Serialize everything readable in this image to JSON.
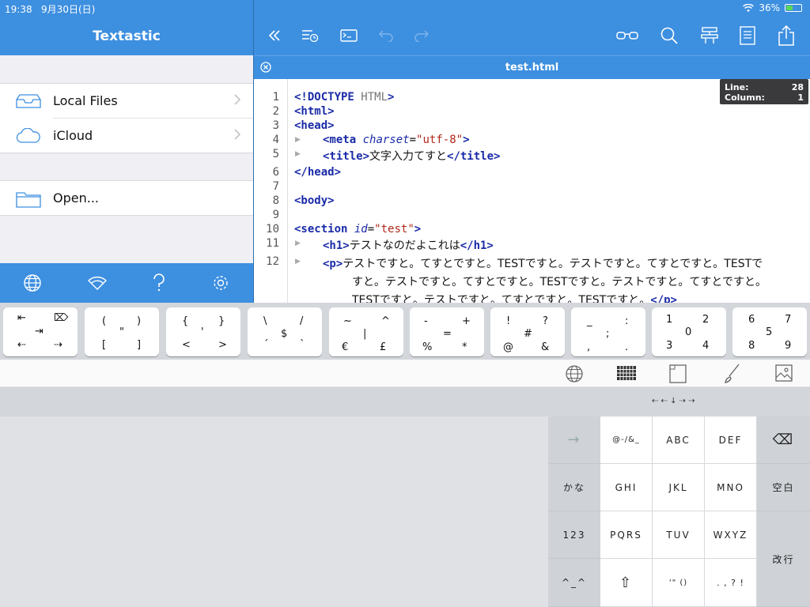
{
  "status": {
    "time": "19:38",
    "date": "9月30日(日)",
    "battery": "36%"
  },
  "sidebar": {
    "title": "Textastic",
    "items": [
      {
        "label": "Local Files",
        "icon": "tray-icon"
      },
      {
        "label": "iCloud",
        "icon": "cloud-icon"
      },
      {
        "label": "Open...",
        "icon": "folder-icon"
      }
    ],
    "footer_icons": [
      "globe-icon",
      "wifi-icon",
      "help-icon",
      "gear-icon"
    ]
  },
  "editor": {
    "file_title": "test.html",
    "line_info": {
      "line_label": "Line:",
      "line": "28",
      "col_label": "Column:",
      "col": "1"
    },
    "lines": [
      {
        "n": "1"
      },
      {
        "n": "2"
      },
      {
        "n": "3"
      },
      {
        "n": "4"
      },
      {
        "n": "5"
      },
      {
        "n": "6"
      },
      {
        "n": "7"
      },
      {
        "n": "8"
      },
      {
        "n": "9"
      },
      {
        "n": "10"
      },
      {
        "n": "11"
      },
      {
        "n": "12"
      }
    ],
    "code": {
      "l1a": "<!DOCTYPE",
      "l1b": " HTML",
      "l1c": ">",
      "l2": "<html>",
      "l3": "<head>",
      "l4a": "<meta",
      "l4b": "charset",
      "l4c": "=",
      "l4d": "\"utf-8\"",
      "l4e": ">",
      "l5a": "<title>",
      "l5b": "文字入力てすと",
      "l5c": "</title>",
      "l6": "</head>",
      "l8": "<body>",
      "l10a": "<section",
      "l10b": "id",
      "l10c": "=",
      "l10d": "\"test\"",
      "l10e": ">",
      "l11a": "<h1>",
      "l11b": "テストなのだよこれは",
      "l11c": "</h1>",
      "l12a": "<p>",
      "l12b": "テストですと。てすとですと。TESTですと。テストですと。てすとですと。TESTで",
      "l12c": "すと。テストですと。てすとですと。TESTですと。テストですと。てすとですと。",
      "l12d": "TESTですと。テストですと。てすとですと。TESTですと。",
      "l12e": "</p>"
    }
  },
  "extkeys": [
    {
      "tl": "⇤",
      "tr": "⌦",
      "c": "",
      "ml": "",
      "mr": "⇥",
      "bl": "⇠",
      "br": "⇢"
    },
    {
      "tl": "(",
      "tr": ")",
      "c": "\"",
      "bl": "[",
      "br": "]"
    },
    {
      "tl": "{",
      "tr": "}",
      "c": "'",
      "bl": "<",
      "br": ">"
    },
    {
      "tl": "\\",
      "tr": "/",
      "c": "$",
      "bl": "´",
      "br": "`"
    },
    {
      "tl": "~",
      "tr": "^",
      "c": "|",
      "bl": "€",
      "br": "£"
    },
    {
      "tl": "-",
      "tr": "+",
      "c": "=",
      "bl": "%",
      "br": "*"
    },
    {
      "tl": "!",
      "tr": "?",
      "c": "#",
      "bl": "@",
      "br": "&"
    },
    {
      "tl": "_",
      "tr": ":",
      "c": ";",
      "bl": ",",
      "br": "."
    },
    {
      "tl": "1",
      "tr": "2",
      "c": "0",
      "bl": "3",
      "br": "4"
    },
    {
      "tl": "6",
      "tr": "7",
      "c": "5",
      "bl": "8",
      "br": "9"
    }
  ],
  "arrow_hint": "⇠ ⇠ ↓ ⇢ ⇢",
  "flick": {
    "arrow": "→",
    "k1": "@-/&_",
    "k2": "ABC",
    "k3": "DEF",
    "del": "⌫",
    "kana": "かな",
    "k4": "GHI",
    "k5": "JKL",
    "k6": "MNO",
    "space": "空白",
    "num": "123",
    "k7": "PQRS",
    "k8": "TUV",
    "k9": "WXYZ",
    "enter": "改行",
    "emoji": "^_^",
    "shift": "⇧",
    "k10": "'\" ()",
    "k11": ". , ? !"
  }
}
